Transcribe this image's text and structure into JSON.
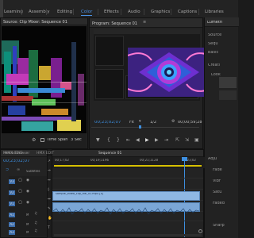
{
  "workspace": {
    "tabs": [
      {
        "label": "Learning"
      },
      {
        "label": "Assembly"
      },
      {
        "label": "Editing"
      },
      {
        "label": "Color"
      },
      {
        "label": "Effects"
      },
      {
        "label": "Audio"
      },
      {
        "label": "Graphics"
      },
      {
        "label": "Captions"
      },
      {
        "label": "Libraries"
      }
    ],
    "active_tab": "Color"
  },
  "source_monitor": {
    "title": "Source: Clip Mixer: Sequence 01",
    "time_span": "Time Span",
    "seconds": "3 Sec"
  },
  "program_monitor": {
    "title": "Program: Sequence 01",
    "timecode_left": "00;23;02;07",
    "fit": "Fit",
    "fraction": "1/2",
    "timecode_right": "00;00;59;28"
  },
  "right_panel": {
    "title": "Lumetri",
    "labels": [
      "Source",
      "Sequ",
      "Basic",
      "Creati",
      "Look",
      "Adju",
      "Fade",
      "Vibr",
      "Satu",
      "Faded",
      "Sharp"
    ]
  },
  "project_panel": {
    "tab_label": "Media Browser",
    "timecode": "00;23;02;07"
  },
  "timeline": {
    "tabs": [
      "HMX EDIT",
      "HMX EDIT",
      "Sequence 01"
    ],
    "ruler_marks": [
      "00;17;02",
      "00;19;1196",
      "00;21;1128",
      "00;23;02"
    ],
    "subtitles_label": "Subtitles",
    "track_labels": [
      "V3",
      "V2",
      "V1",
      "A1",
      "A2",
      "A3"
    ],
    "clip_label": "sample_video_clip_file_01.mp4 [V]"
  },
  "colors": {
    "accent": "#3d8fe0",
    "panel_bg": "#232323",
    "clip_video": "#8fb7e3",
    "clip_audio": "#7aa6d6",
    "in_out_bar": "#d7c000"
  }
}
